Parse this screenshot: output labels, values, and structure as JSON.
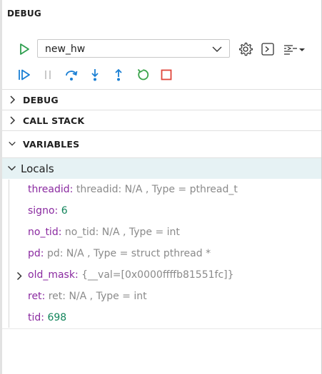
{
  "panel": {
    "title": "DEBUG"
  },
  "launch": {
    "config_value": "new_hw"
  },
  "sections": {
    "debug": "DEBUG",
    "call_stack": "CALL STACK",
    "variables": "VARIABLES"
  },
  "locals": {
    "label": "Locals",
    "items": [
      {
        "name": "threadid",
        "sep": ": ",
        "value": "threadid: N/A , Type = pthread_t",
        "kind": "text"
      },
      {
        "name": "signo",
        "sep": ": ",
        "value": "6",
        "kind": "number"
      },
      {
        "name": "no_tid",
        "sep": ": ",
        "value": "no_tid: N/A , Type = int",
        "kind": "text"
      },
      {
        "name": "pd",
        "sep": ": ",
        "value": "pd: N/A , Type = struct pthread *",
        "kind": "text"
      },
      {
        "name": "old_mask",
        "sep": ": ",
        "value": "{__val=[0x0000ffffb81551fc]}",
        "kind": "text"
      },
      {
        "name": "ret",
        "sep": ": ",
        "value": "ret: N/A , Type = int",
        "kind": "text"
      },
      {
        "name": "tid",
        "sep": ": ",
        "value": "698",
        "kind": "number"
      }
    ]
  },
  "colors": {
    "run_green": "#2e9e4f",
    "toolbar_blue": "#1a7fd4",
    "restart_green": "#3aa34a",
    "stop_red": "#e0453a",
    "variable_name": "#8a2aa0",
    "number_value": "#11845a",
    "muted_value": "#8a8a8a",
    "selection_bg": "#e6f2f4"
  },
  "icons": {
    "run": "play-icon",
    "dropdown": "chevron-down-icon",
    "settings": "gear-icon",
    "console": "terminal-icon",
    "more": "list-menu-icon",
    "continue": "continue-icon",
    "pause": "pause-icon",
    "step_over": "step-over-icon",
    "step_into": "step-into-icon",
    "step_out": "step-out-icon",
    "restart": "restart-icon",
    "stop": "stop-icon"
  }
}
